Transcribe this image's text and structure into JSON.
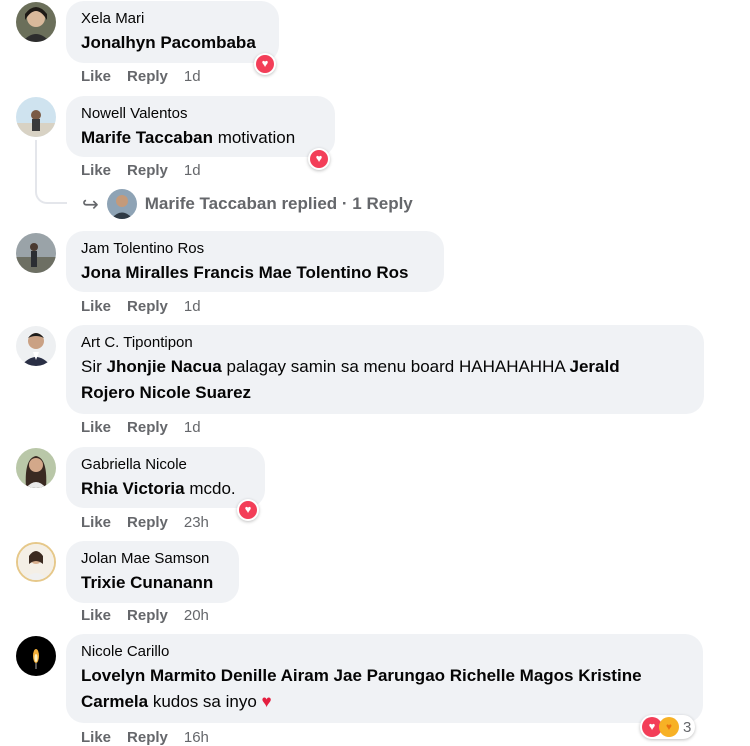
{
  "comments": [
    {
      "author": "Xela Mari",
      "text_parts": [
        "Jonalhyn Pacombaba"
      ],
      "like": "Like",
      "reply": "Reply",
      "time": "1d",
      "reaction": "heart"
    },
    {
      "author": "Nowell Valentos",
      "mention": "Marife Taccaban",
      "rest": " motivation",
      "like": "Like",
      "reply": "Reply",
      "time": "1d",
      "reaction": "heart"
    },
    {
      "author": "Jam Tolentino Ros",
      "mention": "Jona Miralles Francis Mae Tolentino Ros",
      "like": "Like",
      "reply": "Reply",
      "time": "1d"
    },
    {
      "author": "Art C. Tipontipon",
      "pre": "Sir ",
      "mention1": "Jhonjie Nacua",
      "mid": " palagay samin sa menu board HAHAHAHHA ",
      "mention2": "Jerald",
      "mention3": "Rojero Nicole Suarez",
      "like": "Like",
      "reply": "Reply",
      "time": "1d"
    },
    {
      "author": "Gabriella Nicole",
      "mention": "Rhia Victoria",
      "rest": " mcdo.",
      "like": "Like",
      "reply": "Reply",
      "time": "23h",
      "reaction": "heart"
    },
    {
      "author": "Jolan Mae Samson",
      "mention": "Trixie Cunanann",
      "like": "Like",
      "reply": "Reply",
      "time": "20h"
    },
    {
      "author": "Nicole Carillo",
      "mention1": "Lovelyn Marmito Denille Airam Jae Parungao Richelle Magos Kristine",
      "mention2": "Carmela",
      "rest": " kudos sa inyo ",
      "emoji": "♥",
      "like": "Like",
      "reply": "Reply",
      "time": "16h",
      "reaction_count": "3"
    }
  ],
  "reply_thread": {
    "text": "Marife Taccaban replied · 1 Reply"
  },
  "colors": {
    "bubble": "#f0f2f5",
    "secondary_text": "#65676b",
    "heart": "#f33e58"
  }
}
